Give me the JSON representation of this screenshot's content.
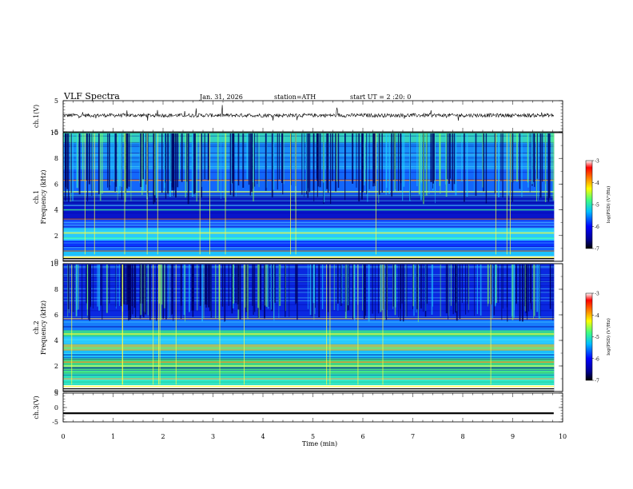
{
  "header": {
    "title": "VLF  Spectra",
    "date": "Jan. 31, 2026",
    "station": "station=ATH",
    "start": "start  UT  =   2  :20: 0"
  },
  "chart_data": [
    {
      "type": "line",
      "panel": "ch1-waveform",
      "ylabel": "ch.1(V)",
      "ylim": [
        -5,
        5
      ],
      "yticks": [
        "5",
        "-5"
      ],
      "xlim": [
        0,
        10
      ],
      "description_values": {
        "baseline": 0.3,
        "noise_amplitude": 0.6,
        "spike_amplitude": 2.5
      },
      "color": "#000000"
    },
    {
      "type": "heatmap",
      "panel": "ch1-spectrogram",
      "ylabel": "ch.1\nFrequency  (kHz)",
      "ylim": [
        0,
        10
      ],
      "yticks": [
        "0",
        "2",
        "4",
        "6",
        "8",
        "10"
      ],
      "xlim": [
        0,
        9.8
      ],
      "colorbar": {
        "label": "log(PSD) (V²/Hz)",
        "range": [
          -7,
          -3
        ],
        "ticks": [
          "-3",
          "-4",
          "-5",
          "-6",
          "-7"
        ]
      },
      "bands_khz": [
        0.3,
        0.8,
        1.8,
        2.2,
        3.3,
        4.0,
        5.4,
        6.3
      ]
    },
    {
      "type": "heatmap",
      "panel": "ch2-spectrogram",
      "ylabel": "ch.2\nFrequency  (kHz)",
      "ylim": [
        0,
        10
      ],
      "yticks": [
        "0",
        "2",
        "4",
        "6",
        "8",
        "10"
      ],
      "xlim": [
        0,
        9.8
      ],
      "colorbar": {
        "label": "log(PSD) (V²/Hz)",
        "range": [
          -7,
          -3
        ],
        "ticks": [
          "-3",
          "-4",
          "-5",
          "-6",
          "-7"
        ]
      },
      "bands_khz": [
        0.4,
        1.0,
        1.6,
        2.0,
        2.3,
        3.4,
        4.5,
        5.7
      ]
    },
    {
      "type": "line",
      "panel": "ch3-waveform",
      "ylabel": "ch.3(V)",
      "ylim": [
        -5,
        5
      ],
      "yticks": [
        "5",
        "0",
        "-5"
      ],
      "xlim": [
        0,
        10
      ],
      "description_values": {
        "baseline": -2,
        "thickness": 0.6
      },
      "color": "#000000"
    }
  ],
  "xaxis": {
    "label": "Time  (min)",
    "ticks": [
      "0",
      "1",
      "2",
      "3",
      "4",
      "5",
      "6",
      "7",
      "8",
      "9",
      "10"
    ],
    "range": [
      0,
      10
    ]
  },
  "colors": {
    "background": "#0a1fd0",
    "jet_stops": [
      "#000000",
      "#00008f",
      "#0000ff",
      "#00bfff",
      "#40ff80",
      "#ffff00",
      "#ff8000",
      "#ff0000",
      "#ffffff"
    ]
  }
}
